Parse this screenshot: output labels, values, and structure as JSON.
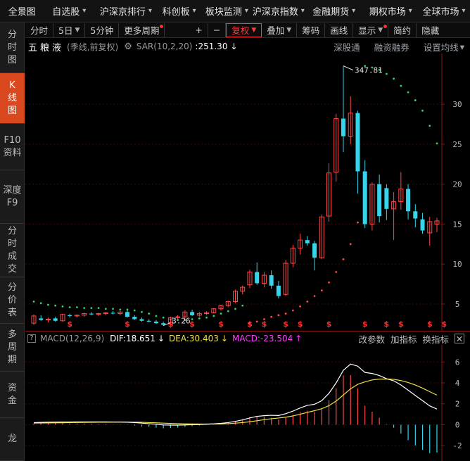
{
  "top_menu": [
    {
      "label": "全景图",
      "arrow": false
    },
    {
      "label": "自选股",
      "arrow": true
    },
    {
      "label": "沪深京排行",
      "arrow": true
    },
    {
      "label": "科创板",
      "arrow": true
    },
    {
      "label": "板块监测",
      "arrow": true
    },
    {
      "label": "沪深京指数",
      "arrow": true
    },
    {
      "label": "金融期货",
      "arrow": true
    },
    {
      "label": "期权市场",
      "arrow": true
    },
    {
      "label": "全球市场",
      "arrow": true
    }
  ],
  "sidebar": [
    "分时图",
    "K线图",
    "F10资料",
    "深度F9",
    "分时成交",
    "分价表",
    "多周期",
    "资金",
    "龙"
  ],
  "sidebar_active_index": 1,
  "toolbar": {
    "fenshi": "分时",
    "day5": "5日",
    "min5": "5分钟",
    "more": "更多周期",
    "plus": "+",
    "minus": "−",
    "fuquan": "复权",
    "diejia": "叠加",
    "chouma": "筹码",
    "huaxian": "画线",
    "xianshi": "显示",
    "jianyue": "简约",
    "yincang": "隐藏"
  },
  "chart_header": {
    "stock_name": "五粮液",
    "period_info": "(季线,前复权)",
    "indicator": "SAR(10,2,20)",
    "indicator_value": ":251.30",
    "links": [
      "深股通",
      "融资融券",
      "设置均线"
    ]
  },
  "macd_header": {
    "help": "?",
    "name": "MACD(12,26,9)",
    "dif_label": "DIF:",
    "dif_value": "18.651",
    "dea_label": "DEA:",
    "dea_value": "30.403",
    "macd_label": "MACD:",
    "macd_value": "-23.504",
    "links": [
      "改参数",
      "加指标",
      "换指标"
    ],
    "close": "✕"
  },
  "colors": {
    "up": "#ff4a4a",
    "down": "#35d6ec",
    "sar_up": "#ff4a4a",
    "sar_down": "#2fcf6c",
    "dif": "#ffffff",
    "dea": "#f0e040",
    "accent": "#d9481e"
  },
  "chart_data": [
    {
      "type": "candlestick",
      "title": "五粮液",
      "y_ticks": [
        5,
        10,
        15,
        20,
        25,
        30
      ],
      "ylim": [
        2,
        36
      ],
      "max_label": "347.81",
      "min_label": "3.26",
      "ohlc": [
        [
          2.6,
          3.7,
          2.4,
          3.5
        ],
        [
          3.2,
          3.6,
          2.9,
          3.0
        ],
        [
          3.0,
          3.3,
          2.7,
          3.1
        ],
        [
          3.2,
          3.4,
          2.8,
          2.9
        ],
        [
          2.9,
          3.8,
          2.8,
          3.7
        ],
        [
          3.6,
          3.8,
          3.3,
          3.5
        ],
        [
          3.5,
          3.7,
          3.3,
          3.6
        ],
        [
          3.6,
          3.9,
          3.4,
          3.8
        ],
        [
          3.8,
          4.0,
          3.6,
          3.7
        ],
        [
          3.7,
          3.9,
          3.5,
          3.8
        ],
        [
          3.8,
          4.0,
          3.6,
          3.9
        ],
        [
          3.9,
          4.1,
          3.7,
          3.8
        ],
        [
          3.8,
          4.1,
          3.6,
          4.0
        ],
        [
          4.0,
          4.2,
          3.3,
          3.4
        ],
        [
          3.4,
          3.6,
          3.0,
          3.1
        ],
        [
          3.1,
          3.3,
          2.8,
          2.9
        ],
        [
          2.9,
          3.1,
          2.7,
          2.8
        ],
        [
          2.8,
          3.0,
          2.5,
          2.6
        ],
        [
          2.6,
          2.8,
          2.3,
          2.4
        ],
        [
          2.5,
          3.4,
          2.4,
          3.3
        ],
        [
          3.3,
          3.6,
          3.1,
          3.4
        ],
        [
          3.4,
          4.2,
          3.2,
          4.0
        ],
        [
          4.0,
          4.3,
          3.5,
          3.6
        ],
        [
          3.6,
          4.0,
          3.4,
          3.8
        ],
        [
          3.8,
          4.1,
          3.6,
          3.9
        ],
        [
          3.9,
          4.5,
          3.8,
          4.4
        ],
        [
          4.4,
          4.9,
          4.2,
          4.8
        ],
        [
          4.8,
          5.4,
          4.6,
          5.3
        ],
        [
          5.3,
          6.8,
          5.1,
          6.6
        ],
        [
          6.6,
          7.3,
          6.2,
          7.1
        ],
        [
          7.4,
          9.3,
          7.0,
          9.0
        ],
        [
          9.0,
          10.2,
          7.4,
          7.6
        ],
        [
          7.6,
          9.0,
          7.1,
          8.6
        ],
        [
          8.6,
          9.2,
          6.9,
          7.3
        ],
        [
          7.3,
          7.9,
          5.7,
          6.0
        ],
        [
          6.2,
          10.5,
          6.0,
          10.1
        ],
        [
          10.1,
          12.4,
          9.6,
          12.0
        ],
        [
          12.0,
          13.8,
          11.2,
          13.0
        ],
        [
          13.0,
          13.5,
          12.3,
          12.6
        ],
        [
          12.6,
          12.9,
          9.2,
          10.8
        ],
        [
          10.8,
          16.2,
          10.6,
          15.9
        ],
        [
          16.0,
          22.6,
          15.3,
          21.4
        ],
        [
          21.5,
          28.8,
          20.3,
          28.2
        ],
        [
          28.2,
          34.8,
          24.0,
          26.0
        ],
        [
          26.0,
          31.0,
          25.0,
          28.9
        ],
        [
          28.9,
          29.2,
          18.8,
          21.6
        ],
        [
          21.6,
          23.0,
          14.5,
          15.0
        ],
        [
          15.0,
          20.2,
          14.2,
          20.0
        ],
        [
          20.0,
          21.2,
          15.2,
          16.0
        ],
        [
          19.5,
          20.0,
          15.5,
          16.9
        ],
        [
          16.9,
          19.0,
          13.0,
          17.8
        ],
        [
          17.8,
          21.5,
          16.8,
          19.4
        ],
        [
          19.4,
          20.0,
          15.6,
          16.6
        ],
        [
          16.6,
          17.5,
          14.6,
          15.7
        ],
        [
          15.6,
          16.4,
          13.8,
          14.2
        ],
        [
          13.9,
          15.9,
          12.3,
          15.3
        ],
        [
          15.0,
          15.8,
          14.0,
          15.4
        ]
      ],
      "sar": [
        [
          5.3,
          "down"
        ],
        [
          5.1,
          "down"
        ],
        [
          4.9,
          "down"
        ],
        [
          4.8,
          "down"
        ],
        [
          4.7,
          "down"
        ],
        [
          4.6,
          "down"
        ],
        [
          4.6,
          "down"
        ],
        [
          4.5,
          "down"
        ],
        [
          4.5,
          "down"
        ],
        [
          4.5,
          "down"
        ],
        [
          4.4,
          "down"
        ],
        [
          4.4,
          "down"
        ],
        [
          4.3,
          "down"
        ],
        [
          4.3,
          "down"
        ],
        [
          4.2,
          "down"
        ],
        [
          4.0,
          "down"
        ],
        [
          3.8,
          "down"
        ],
        [
          3.5,
          "down"
        ],
        [
          3.3,
          "down"
        ],
        [
          3.1,
          "down"
        ],
        [
          3.0,
          "down"
        ],
        [
          3.0,
          "down"
        ],
        [
          3.1,
          "down"
        ],
        [
          3.2,
          "down"
        ],
        [
          3.3,
          "down"
        ],
        [
          3.5,
          "down"
        ],
        [
          3.8,
          "down"
        ],
        [
          4.1,
          "down"
        ],
        [
          4.4,
          "down"
        ],
        [
          4.8,
          "down"
        ],
        [
          2.6,
          "up"
        ],
        [
          2.8,
          "up"
        ],
        [
          3.1,
          "up"
        ],
        [
          3.4,
          "up"
        ],
        [
          3.6,
          "up"
        ],
        [
          3.8,
          "up"
        ],
        [
          4.2,
          "up"
        ],
        [
          4.7,
          "up"
        ],
        [
          5.3,
          "up"
        ],
        [
          6.0,
          "up"
        ],
        [
          6.7,
          "up"
        ],
        [
          7.7,
          "up"
        ],
        [
          9.0,
          "up"
        ],
        [
          10.6,
          "up"
        ],
        [
          12.5,
          "up"
        ],
        [
          15.2,
          "up"
        ],
        [
          34.8,
          "down"
        ],
        [
          34.6,
          "down"
        ],
        [
          34.3,
          "down"
        ],
        [
          33.8,
          "down"
        ],
        [
          33.2,
          "down"
        ],
        [
          32.3,
          "down"
        ],
        [
          31.5,
          "down"
        ],
        [
          30.5,
          "down"
        ],
        [
          29.2,
          "down"
        ],
        [
          27.3,
          "down"
        ],
        [
          25.1,
          "down"
        ]
      ],
      "signal_indices": [
        5,
        13,
        19,
        22,
        26,
        30,
        32,
        35,
        37,
        41,
        46,
        49,
        51,
        55,
        57
      ]
    },
    {
      "type": "macd",
      "y_ticks": [
        6,
        4,
        2,
        0,
        -2
      ],
      "ylim": [
        -3,
        7.5
      ],
      "dif": [
        0.2,
        0.22,
        0.24,
        0.25,
        0.26,
        0.26,
        0.27,
        0.27,
        0.27,
        0.27,
        0.27,
        0.26,
        0.26,
        0.24,
        0.2,
        0.15,
        0.1,
        0.04,
        -0.02,
        -0.04,
        -0.04,
        -0.02,
        0.0,
        0.02,
        0.05,
        0.08,
        0.13,
        0.2,
        0.32,
        0.46,
        0.65,
        0.8,
        0.86,
        0.9,
        0.88,
        1.05,
        1.3,
        1.6,
        1.85,
        1.95,
        2.3,
        3.0,
        4.0,
        5.2,
        5.8,
        5.6,
        5.0,
        4.9,
        4.7,
        4.4,
        4.2,
        3.8,
        3.3,
        2.8,
        2.3,
        1.8,
        1.5
      ],
      "dea": [
        0.15,
        0.16,
        0.17,
        0.18,
        0.19,
        0.2,
        0.21,
        0.22,
        0.23,
        0.24,
        0.24,
        0.25,
        0.25,
        0.25,
        0.24,
        0.23,
        0.2,
        0.18,
        0.15,
        0.12,
        0.1,
        0.08,
        0.07,
        0.06,
        0.06,
        0.07,
        0.08,
        0.1,
        0.15,
        0.2,
        0.28,
        0.38,
        0.48,
        0.57,
        0.64,
        0.72,
        0.84,
        1.0,
        1.18,
        1.34,
        1.53,
        1.82,
        2.26,
        2.84,
        3.43,
        3.86,
        4.1,
        4.28,
        4.36,
        4.37,
        4.34,
        4.22,
        4.04,
        3.79,
        3.5,
        3.16,
        2.83
      ],
      "macd": [
        0.1,
        0.12,
        0.14,
        0.14,
        0.14,
        0.12,
        0.12,
        0.1,
        0.08,
        0.06,
        0.06,
        0.02,
        0.02,
        -0.02,
        -0.08,
        -0.16,
        -0.2,
        -0.28,
        -0.34,
        -0.32,
        -0.28,
        -0.2,
        -0.14,
        -0.08,
        -0.02,
        0.02,
        0.1,
        0.2,
        0.34,
        0.52,
        0.74,
        0.84,
        0.76,
        0.66,
        0.48,
        0.66,
        0.92,
        1.2,
        1.34,
        1.22,
        1.54,
        2.36,
        3.48,
        4.72,
        4.74,
        3.48,
        1.8,
        1.24,
        0.68,
        0.06,
        -0.28,
        -0.84,
        -1.48,
        -1.98,
        -2.4,
        -2.72,
        -2.66
      ]
    }
  ]
}
